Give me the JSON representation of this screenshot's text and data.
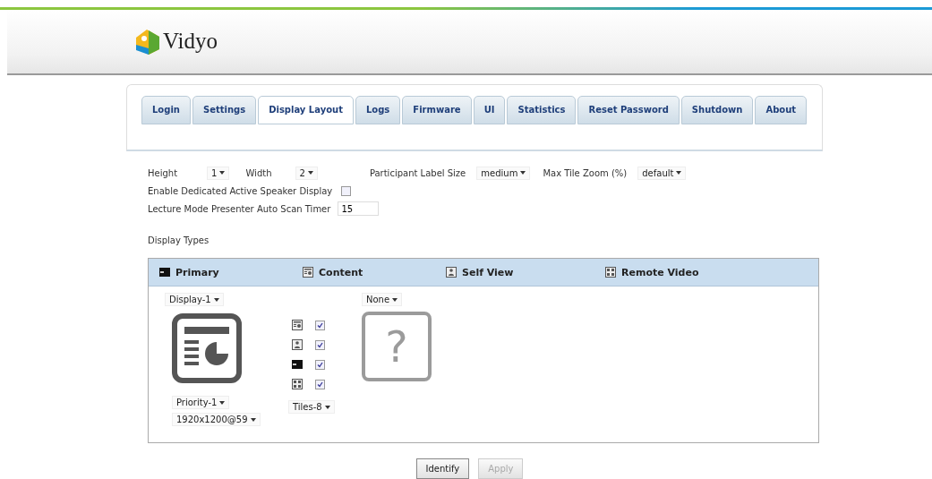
{
  "logo": {
    "text": "Vidyo"
  },
  "tabs": [
    {
      "label": "Login",
      "selected": false
    },
    {
      "label": "Settings",
      "selected": false
    },
    {
      "label": "Display Layout",
      "selected": true
    },
    {
      "label": "Logs",
      "selected": false
    },
    {
      "label": "Firmware",
      "selected": false
    },
    {
      "label": "UI",
      "selected": false
    },
    {
      "label": "Statistics",
      "selected": false
    },
    {
      "label": "Reset Password",
      "selected": false
    },
    {
      "label": "Shutdown",
      "selected": false
    },
    {
      "label": "About",
      "selected": false
    }
  ],
  "layout_row": [
    {
      "label": "Height",
      "value": "1"
    },
    {
      "label": "Width",
      "value": "2"
    },
    {
      "label": "Participant Label Size",
      "value": "medium"
    },
    {
      "label": "Max Tile Zoom (%)",
      "value": "default"
    }
  ],
  "active_speaker": {
    "label": "Enable Dedicated Active Speaker Display",
    "checked": false
  },
  "scan_timer": {
    "label": "Lecture Mode Presenter Auto Scan Timer",
    "value": "15"
  },
  "display_types": {
    "title": "Display Types",
    "columns": [
      {
        "kind": "primary",
        "label": "Primary"
      },
      {
        "kind": "content",
        "label": "Content"
      },
      {
        "kind": "self",
        "label": "Self View"
      },
      {
        "kind": "remote",
        "label": "Remote Video"
      }
    ],
    "display_select": "Display-1",
    "sources": [
      {
        "kind": "content",
        "checked": true
      },
      {
        "kind": "self",
        "checked": true
      },
      {
        "kind": "primary",
        "checked": true
      },
      {
        "kind": "remote",
        "checked": true
      }
    ],
    "priority": "Priority-1",
    "tiles": "Tiles-8",
    "resolution": "1920x1200@59",
    "second_select": "None",
    "unknown_mark": "?"
  },
  "buttons": [
    {
      "label": "Identify",
      "disabled": false
    },
    {
      "label": "Apply",
      "disabled": true
    }
  ]
}
